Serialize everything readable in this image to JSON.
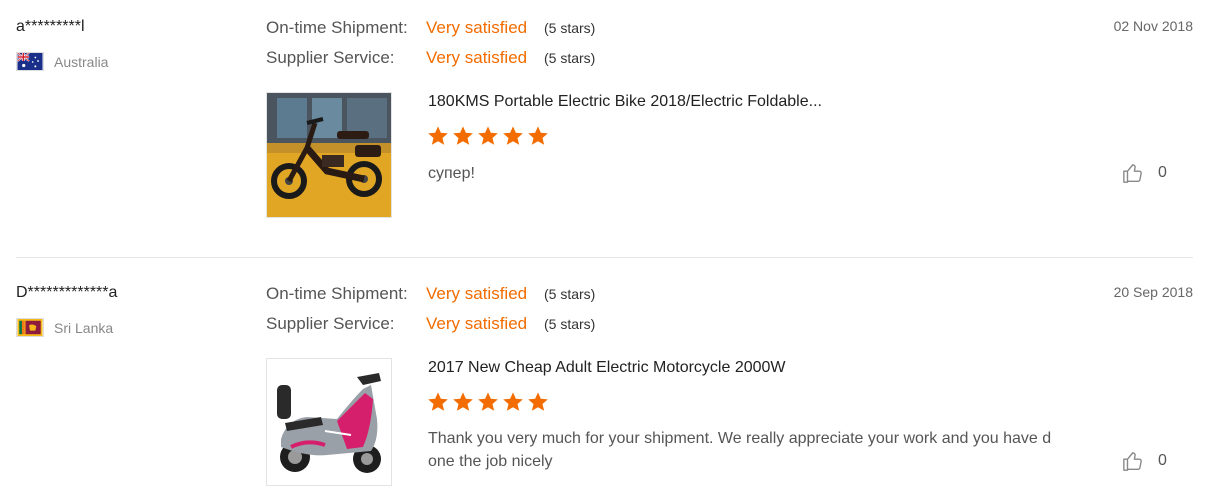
{
  "reviews": [
    {
      "buyer": "a*********l",
      "country": "Australia",
      "flag_icon": "australia-flag-icon",
      "ratings": [
        {
          "label": "On-time Shipment:",
          "value": "Very satisfied",
          "stars_text": "(5 stars)"
        },
        {
          "label": "Supplier Service:",
          "value": "Very satisfied",
          "stars_text": "(5 stars)"
        }
      ],
      "date": "02 Nov 2018",
      "product_title": "180KMS Portable Electric Bike 2018/Electric Foldable...",
      "product_stars": 5,
      "comment": "супер!",
      "helpful_count": "0"
    },
    {
      "buyer": "D*************a",
      "country": "Sri Lanka",
      "flag_icon": "sri-lanka-flag-icon",
      "ratings": [
        {
          "label": "On-time Shipment:",
          "value": "Very satisfied",
          "stars_text": "(5 stars)"
        },
        {
          "label": "Supplier Service:",
          "value": "Very satisfied",
          "stars_text": "(5 stars)"
        }
      ],
      "date": "20 Sep 2018",
      "product_title": "2017 New Cheap Adult Electric Motorcycle 2000W",
      "product_stars": 5,
      "comment": "Thank you very much for your shipment. We really appreciate your work and you have done the job nicely",
      "helpful_count": "0"
    }
  ],
  "colors": {
    "accent": "#f26c00",
    "star": "#f26c00",
    "divider": "#e6e6e6"
  }
}
